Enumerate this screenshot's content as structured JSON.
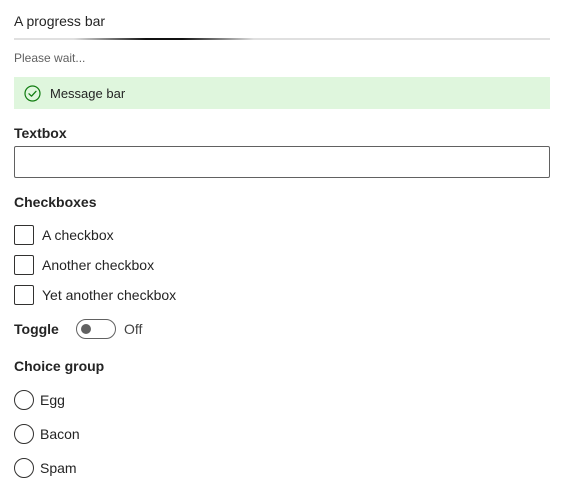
{
  "progress": {
    "label": "A progress bar",
    "description": "Please wait...",
    "indeterminate": true
  },
  "message_bar": {
    "text": "Message bar",
    "icon": "success-check-icon",
    "background": "#dff6dd",
    "icon_color": "#107c10"
  },
  "textbox": {
    "label": "Textbox",
    "value": "",
    "placeholder": ""
  },
  "checkboxes": {
    "label": "Checkboxes",
    "items": [
      {
        "label": "A checkbox",
        "checked": false
      },
      {
        "label": "Another checkbox",
        "checked": false
      },
      {
        "label": "Yet another checkbox",
        "checked": false
      }
    ]
  },
  "toggle": {
    "label": "Toggle",
    "state_text": "Off",
    "on": false
  },
  "choice_group": {
    "label": "Choice group",
    "options": [
      {
        "label": "Egg",
        "selected": false
      },
      {
        "label": "Bacon",
        "selected": false
      },
      {
        "label": "Spam",
        "selected": false
      }
    ]
  }
}
